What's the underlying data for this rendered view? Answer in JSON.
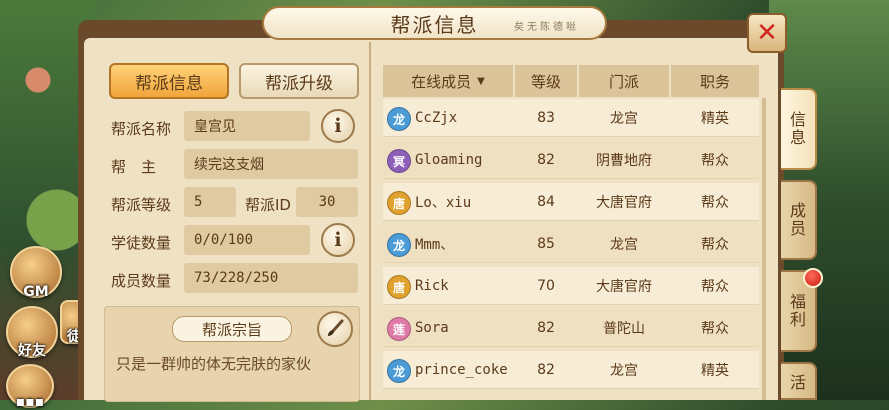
{
  "dialog": {
    "title": "帮派信息",
    "title_decoration": "矣无陈德咝"
  },
  "side_buttons": {
    "gm": "GM",
    "friends": "好友",
    "partial": "徒"
  },
  "tabs": {
    "info": "帮派信息",
    "upgrade": "帮派升级"
  },
  "fields": {
    "name_label": "帮派名称",
    "name_value": "皇宫见",
    "leader_label": "帮　主",
    "leader_value": "续完这支烟",
    "level_label": "帮派等级",
    "level_value": "5",
    "id_label": "帮派ID",
    "id_value": "30",
    "apprentice_label": "学徒数量",
    "apprentice_value": "0/0/100",
    "member_label": "成员数量",
    "member_value": "73/228/250"
  },
  "info_icon_glyph": "i",
  "motto": {
    "title": "帮派宗旨",
    "text": "只是一群帅的体无完肤的家伙"
  },
  "table": {
    "headers": {
      "member": "在线成员",
      "level": "等级",
      "school": "门派",
      "role": "职务"
    },
    "sort_arrow": "▼",
    "rows": [
      {
        "name": "CcZjx",
        "level": "83",
        "school": "龙宫",
        "role": "精英",
        "icon": "dragon-palace-icon",
        "color": "#4a9bd6",
        "glyph": "龙"
      },
      {
        "name": "Gloaming",
        "level": "82",
        "school": "阴曹地府",
        "role": "帮众",
        "icon": "underworld-icon",
        "color": "#8e5fb8",
        "glyph": "冥"
      },
      {
        "name": "Lo、xiu",
        "level": "84",
        "school": "大唐官府",
        "role": "帮众",
        "icon": "tang-office-icon",
        "color": "#e0a12e",
        "glyph": "唐"
      },
      {
        "name": "Mmm、",
        "level": "85",
        "school": "龙宫",
        "role": "帮众",
        "icon": "dragon-palace-icon",
        "color": "#4a9bd6",
        "glyph": "龙"
      },
      {
        "name": "Rick",
        "level": "70",
        "school": "大唐官府",
        "role": "帮众",
        "icon": "tang-office-icon",
        "color": "#e0a12e",
        "glyph": "唐"
      },
      {
        "name": "Sora",
        "level": "82",
        "school": "普陀山",
        "role": "帮众",
        "icon": "putuo-icon",
        "color": "#e07aa6",
        "glyph": "莲"
      },
      {
        "name": "prince_coke",
        "level": "82",
        "school": "龙宫",
        "role": "精英",
        "icon": "dragon-palace-icon",
        "color": "#4a9bd6",
        "glyph": "龙"
      }
    ]
  },
  "side_tabs": {
    "info": "信息",
    "members": "成员",
    "welfare": "福利",
    "activity": "活"
  },
  "colors": {
    "accent": "#f0a53a",
    "brown_text": "#5b3a1a",
    "close_red": "#d0281e"
  }
}
